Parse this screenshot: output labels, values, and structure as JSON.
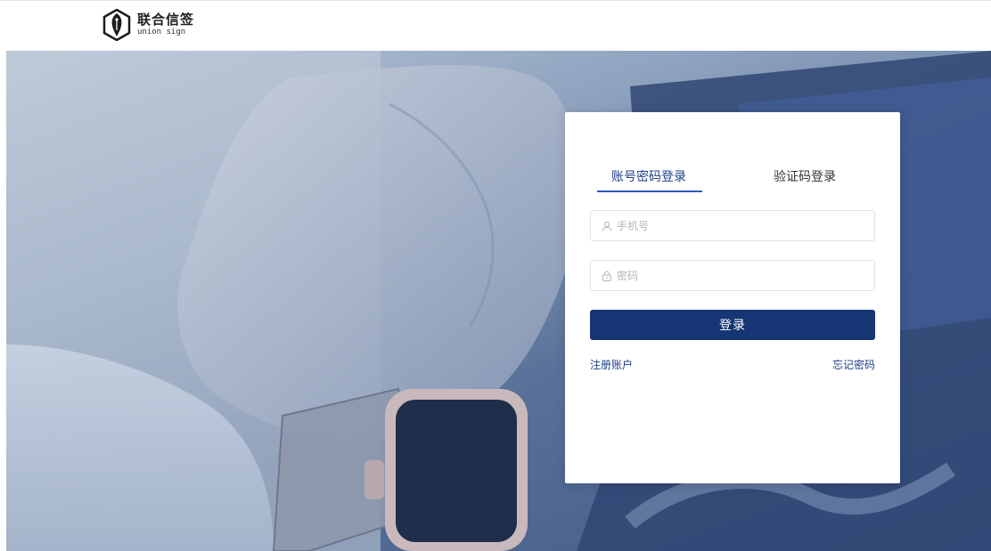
{
  "brand": {
    "name_cn": "联合信签",
    "name_en": "union sign"
  },
  "login": {
    "tabs": [
      {
        "label": "账号密码登录",
        "active": true
      },
      {
        "label": "验证码登录",
        "active": false
      }
    ],
    "phone": {
      "placeholder": "手机号",
      "value": "",
      "icon": "user-icon"
    },
    "password": {
      "placeholder": "密码",
      "value": "",
      "icon": "lock-icon"
    },
    "submit_label": "登录",
    "register_label": "注册账户",
    "forgot_label": "忘记密码"
  },
  "colors": {
    "primary": "#153574",
    "link": "#1e3f86",
    "tab_indicator": "#2d5bb8"
  }
}
